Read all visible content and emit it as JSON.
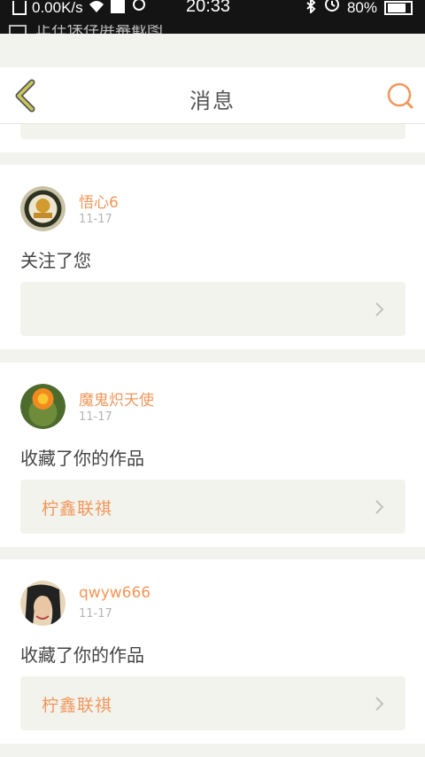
{
  "status_bar": {
    "network_speed": "0.00K/s",
    "time": "20:33",
    "battery": "80%",
    "notification": "正在保存屏幕截图"
  },
  "nav": {
    "title": "消息",
    "back_icon": "back-chevron-icon",
    "search_icon": "search-icon"
  },
  "colors": {
    "accent": "#f0975b",
    "back_icon": "#c8c85a",
    "background": "#f2f2ef",
    "link_box": "#f3f3ed"
  },
  "messages": [
    {
      "username": "悟心6",
      "date": "11-17",
      "action": "关注了您",
      "link_title": ""
    },
    {
      "username": "魔鬼炽天使",
      "date": "11-17",
      "action": "收藏了你的作品",
      "link_title": "柠鑫联祺"
    },
    {
      "username": "qwyw666",
      "date": "11-17",
      "action": "收藏了你的作品",
      "link_title": "柠鑫联祺"
    }
  ]
}
